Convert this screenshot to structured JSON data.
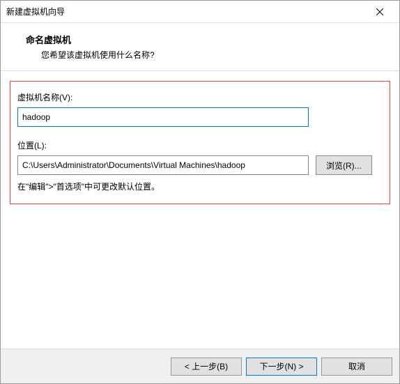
{
  "window": {
    "title": "新建虚拟机向导"
  },
  "header": {
    "title": "命名虚拟机",
    "subtitle": "您希望该虚拟机使用什么名称?"
  },
  "form": {
    "name_label": "虚拟机名称(V):",
    "name_value": "hadoop",
    "location_label": "位置(L):",
    "location_value": "C:\\Users\\Administrator\\Documents\\Virtual Machines\\hadoop",
    "browse_label": "浏览(R)...",
    "hint": "在\"编辑\">\"首选项\"中可更改默认位置。"
  },
  "footer": {
    "back_label": "< 上一步(B)",
    "next_label": "下一步(N) >",
    "cancel_label": "取消"
  }
}
